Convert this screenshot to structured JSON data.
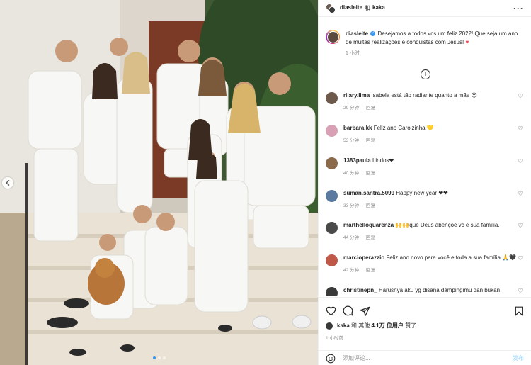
{
  "header": {
    "user1": "diasleite",
    "joiner": "和",
    "user2": "kaka",
    "more_icon": "more-horizontal-icon"
  },
  "caption": {
    "username": "diasleite",
    "text": "Desejamos a todos vcs um feliz 2022! Que seja um ano de muitas realizações e conquistas com Jesus!",
    "emoji": "♥",
    "time": "1 小时"
  },
  "load_more_icon": "plus-circle-icon",
  "comments": [
    {
      "username": "rilary.lima",
      "text": "Isabela está tão radiante quanto a mãe 😍",
      "time": "29 分钟",
      "reply": "回复",
      "avatar_color": "#6e5a4c"
    },
    {
      "username": "barbara.kk",
      "text": "Feliz ano Carolzinha 💛",
      "time": "53 分钟",
      "reply": "回复",
      "avatar_color": "#d7a0b4"
    },
    {
      "username": "1383paula",
      "text": "Lindos❤",
      "time": "40 分钟",
      "reply": "回复",
      "avatar_color": "#8a6a4a"
    },
    {
      "username": "suman.santra.5099",
      "text": "Happy new year ❤❤",
      "time": "33 分钟",
      "reply": "回复",
      "avatar_color": "#5a7aa0"
    },
    {
      "username": "marthelloquarenza",
      "text": "🙌🙌que Deus abençoe vc e sua família.",
      "time": "44 分钟",
      "reply": "回复",
      "avatar_color": "#4a4a4a"
    },
    {
      "username": "marcioperazzio",
      "text": "Feliz ano novo para você e toda a sua família 🙏🖤",
      "time": "42 分钟",
      "reply": "回复",
      "avatar_color": "#c0584a"
    },
    {
      "username": "christinepn_",
      "text": "Harusnya aku yg disana dampingimu dan bukan",
      "time": "",
      "reply": "",
      "avatar_color": "#3a3a3a"
    }
  ],
  "actions": {
    "like_icon": "heart-icon",
    "comment_icon": "comment-icon",
    "share_icon": "send-icon",
    "save_icon": "bookmark-icon"
  },
  "likes": {
    "liker": "kaka",
    "middle": "和 其他",
    "count": "4.1万 位用户",
    "suffix": "赞了"
  },
  "posted_time": "1 小时前",
  "add_comment": {
    "placeholder": "添加评论...",
    "post_label": "发布",
    "emoji_icon": "smiley-icon"
  },
  "photo": {
    "nav_icon": "chevron-left-icon"
  }
}
